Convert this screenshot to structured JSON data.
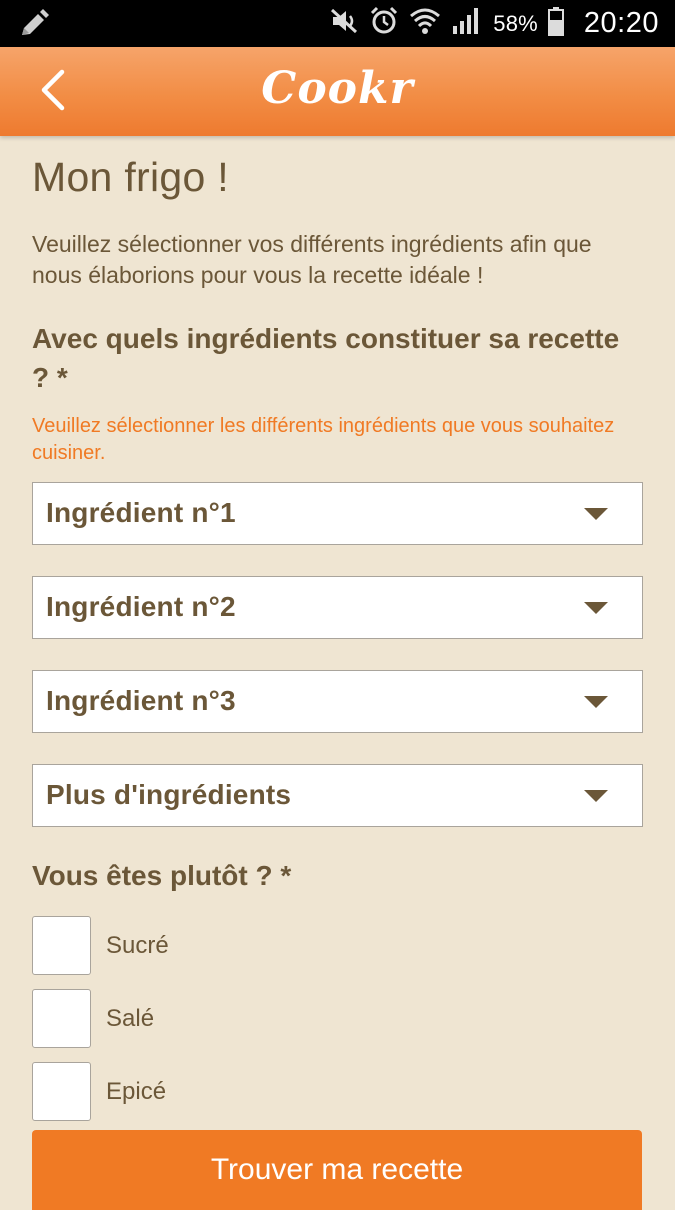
{
  "status_bar": {
    "battery": "58%",
    "time": "20:20",
    "icons": [
      "edit-icon",
      "mute-icon",
      "alarm-icon",
      "wifi-icon",
      "signal-icon",
      "battery-icon"
    ]
  },
  "app_bar": {
    "title": "Cookr",
    "back_icon": "chevron-left-icon"
  },
  "page": {
    "title": "Mon frigo !",
    "intro": "Veuillez sélectionner vos différents ingrédients afin que nous élaborions pour vous la recette idéale !",
    "question": "Avec quels ingrédients constituer sa recette ? *",
    "hint": "Veuillez sélectionner les différents ingrédients que vous souhaitez cuisiner.",
    "selects": [
      {
        "label": "Ingrédient n°1"
      },
      {
        "label": "Ingrédient n°2"
      },
      {
        "label": "Ingrédient n°3"
      },
      {
        "label": "Plus d'ingrédients"
      }
    ],
    "question_2": "Vous êtes plutôt ? *",
    "options": [
      {
        "label": "Sucré",
        "checked": false
      },
      {
        "label": "Salé",
        "checked": false
      },
      {
        "label": "Epicé",
        "checked": false
      }
    ],
    "submit_label": "Trouver ma recette"
  },
  "colors": {
    "background": "#efe5d2",
    "accent": "#f07a24",
    "text": "#6b5738"
  }
}
